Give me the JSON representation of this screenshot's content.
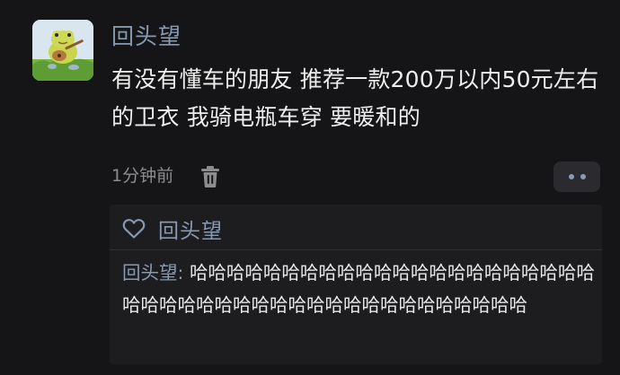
{
  "post": {
    "author": "回头望",
    "text": "有没有懂车的朋友 推荐一款200万以内50元左右的卫衣 我骑电瓶车穿 要暖和的",
    "time": "1分钟前"
  },
  "likes": {
    "users": "回头望"
  },
  "comment": {
    "author": "回头望",
    "separator": ": ",
    "text": "哈哈哈哈哈哈哈哈哈哈哈哈哈哈哈哈哈哈哈哈哈哈哈哈哈哈哈哈哈哈哈哈哈哈哈哈哈哈哈哈哈哈哈哈"
  },
  "icons": {
    "avatar": "frog-with-guitar-avatar",
    "delete": "trash-icon",
    "more": "more-dots-icon",
    "like": "heart-outline-icon"
  },
  "colors": {
    "background": "#151517",
    "name": "#8699b1",
    "text": "#ededed",
    "meta": "#8c8c8e",
    "panel": "#1d1d20"
  }
}
